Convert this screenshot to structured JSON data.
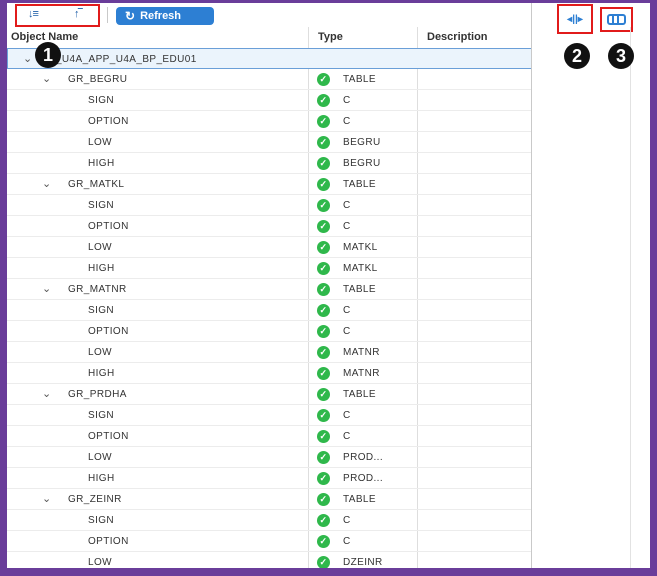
{
  "toolbar": {
    "sort_ascending_icon": "sort-ascending-icon",
    "sort_descending_icon": "sort-descending-icon",
    "refresh_label": "Refresh",
    "split_columns_icon": "column-split-icon",
    "column_settings_icon": "columns-icon"
  },
  "badges": [
    "1",
    "2",
    "3"
  ],
  "columns": {
    "name": "Object Name",
    "type": "Type",
    "description": "Description"
  },
  "rows": [
    {
      "level": 0,
      "name": "L_U4A_APP_U4A_BP_EDU01",
      "type": "",
      "expandable": true,
      "selected": true
    },
    {
      "level": 1,
      "name": "GR_BEGRU",
      "type": "TABLE",
      "expandable": true
    },
    {
      "level": 2,
      "name": "SIGN",
      "type": "C"
    },
    {
      "level": 2,
      "name": "OPTION",
      "type": "C"
    },
    {
      "level": 2,
      "name": "LOW",
      "type": "BEGRU"
    },
    {
      "level": 2,
      "name": "HIGH",
      "type": "BEGRU"
    },
    {
      "level": 1,
      "name": "GR_MATKL",
      "type": "TABLE",
      "expandable": true
    },
    {
      "level": 2,
      "name": "SIGN",
      "type": "C"
    },
    {
      "level": 2,
      "name": "OPTION",
      "type": "C"
    },
    {
      "level": 2,
      "name": "LOW",
      "type": "MATKL"
    },
    {
      "level": 2,
      "name": "HIGH",
      "type": "MATKL"
    },
    {
      "level": 1,
      "name": "GR_MATNR",
      "type": "TABLE",
      "expandable": true
    },
    {
      "level": 2,
      "name": "SIGN",
      "type": "C"
    },
    {
      "level": 2,
      "name": "OPTION",
      "type": "C"
    },
    {
      "level": 2,
      "name": "LOW",
      "type": "MATNR"
    },
    {
      "level": 2,
      "name": "HIGH",
      "type": "MATNR"
    },
    {
      "level": 1,
      "name": "GR_PRDHA",
      "type": "TABLE",
      "expandable": true
    },
    {
      "level": 2,
      "name": "SIGN",
      "type": "C"
    },
    {
      "level": 2,
      "name": "OPTION",
      "type": "C"
    },
    {
      "level": 2,
      "name": "LOW",
      "type": "PROD..."
    },
    {
      "level": 2,
      "name": "HIGH",
      "type": "PROD..."
    },
    {
      "level": 1,
      "name": "GR_ZEINR",
      "type": "TABLE",
      "expandable": true
    },
    {
      "level": 2,
      "name": "SIGN",
      "type": "C"
    },
    {
      "level": 2,
      "name": "OPTION",
      "type": "C"
    },
    {
      "level": 2,
      "name": "LOW",
      "type": "DZEINR"
    }
  ],
  "colors": {
    "frame": "#6a3d9a",
    "highlight_box": "#e11b1b",
    "accent": "#2d7fd3",
    "status_ok": "#2fb84b"
  }
}
